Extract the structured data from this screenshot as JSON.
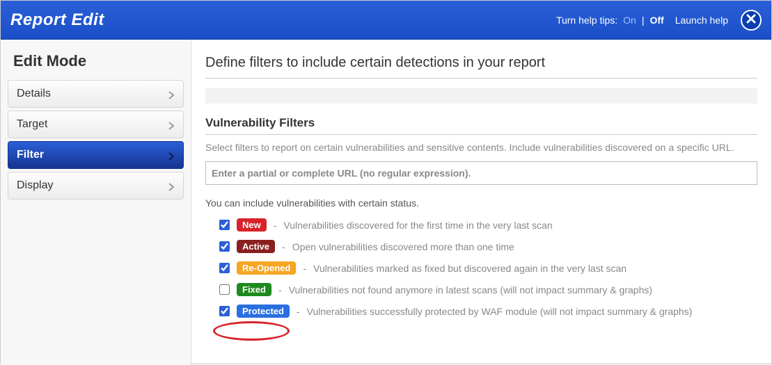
{
  "header": {
    "title": "Report Edit",
    "help_tips_label": "Turn help tips:",
    "help_on": "On",
    "help_sep": "|",
    "help_off": "Off",
    "launch_help": "Launch help"
  },
  "sidebar": {
    "title": "Edit Mode",
    "items": [
      {
        "label": "Details",
        "active": false
      },
      {
        "label": "Target",
        "active": false
      },
      {
        "label": "Filter",
        "active": true
      },
      {
        "label": "Display",
        "active": false
      }
    ]
  },
  "main": {
    "title": "Define filters to include certain detections in your report",
    "vuln_filters_title": "Vulnerability Filters",
    "vuln_filters_desc": "Select filters to report on certain vulnerabilities and sensitive contents. Include vulnerabilities discovered on a specific URL.",
    "url_placeholder": "Enter a partial or complete URL (no regular expression).",
    "status_intro": "You can include vulnerabilities with certain status.",
    "statuses": [
      {
        "key": "new",
        "checked": true,
        "badge": "New",
        "badge_class": "badge-new",
        "desc": "Vulnerabilities discovered for the first time in the very last scan"
      },
      {
        "key": "active",
        "checked": true,
        "badge": "Active",
        "badge_class": "badge-active",
        "desc": "Open vulnerabilities discovered more than one time"
      },
      {
        "key": "reopened",
        "checked": true,
        "badge": "Re-Opened",
        "badge_class": "badge-reopened",
        "desc": "Vulnerabilities marked as fixed but discovered again in the very last scan"
      },
      {
        "key": "fixed",
        "checked": false,
        "badge": "Fixed",
        "badge_class": "badge-fixed",
        "desc": "Vulnerabilities not found anymore in latest scans (will not impact summary & graphs)"
      },
      {
        "key": "protected",
        "checked": true,
        "badge": "Protected",
        "badge_class": "badge-protected",
        "desc": "Vulnerabilities successfully protected by WAF module (will not impact summary & graphs)"
      }
    ],
    "dash": "-"
  }
}
